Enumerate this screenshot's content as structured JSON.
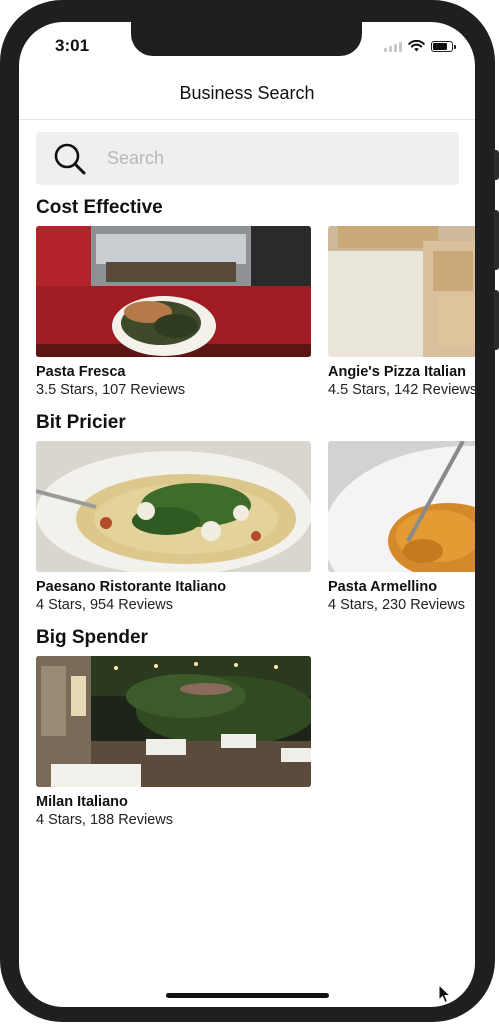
{
  "status_bar": {
    "time": "3:01",
    "battery_level": 0.85
  },
  "nav": {
    "title": "Business Search"
  },
  "search": {
    "placeholder": "Search",
    "value": ""
  },
  "sections": [
    {
      "title": "Cost Effective",
      "items": [
        {
          "name": "Pasta Fresca",
          "meta": "3.5 Stars, 107 Reviews",
          "image": "pasta-plate-counter"
        },
        {
          "name": "Angie's Pizza Italian",
          "meta": "4.5 Stars, 142 Reviews",
          "image": "pizza-crust"
        }
      ]
    },
    {
      "title": "Bit Pricier",
      "items": [
        {
          "name": "Paesano Ristorante Italiano",
          "meta": "4 Stars, 954 Reviews",
          "image": "spaghetti-greens"
        },
        {
          "name": "Pasta Armellino",
          "meta": "4 Stars, 230 Reviews",
          "image": "pasta-fork"
        }
      ]
    },
    {
      "title": "Big Spender",
      "items": [
        {
          "name": "Milan Italiano",
          "meta": "4 Stars, 188 Reviews",
          "image": "patio-night-lights"
        }
      ]
    }
  ],
  "colors": {
    "bezel": "#1f1f21",
    "search_bg": "#efefef",
    "placeholder": "#b8b8b8",
    "text": "#111111"
  },
  "icons": [
    "search-icon",
    "wifi-icon",
    "battery-icon",
    "signal-icon",
    "mouse-cursor-icon"
  ]
}
